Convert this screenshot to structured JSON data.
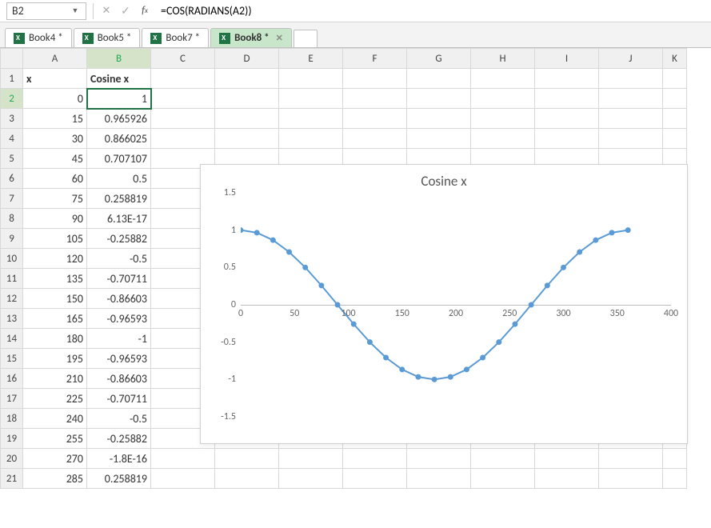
{
  "formula_bar": {
    "name_box": "B2",
    "formula": "=COS(RADIANS(A2))"
  },
  "workbook_tabs": [
    {
      "label": "Book4 *"
    },
    {
      "label": "Book5 *"
    },
    {
      "label": "Book7 *"
    },
    {
      "label": "Book8 *",
      "active": true
    }
  ],
  "columns": [
    "A",
    "B",
    "C",
    "D",
    "E",
    "F",
    "G",
    "H",
    "I",
    "J",
    "K"
  ],
  "header_row": {
    "A": "x",
    "B": "Cosine x"
  },
  "active_cell": "B2",
  "rows": [
    {
      "n": 1,
      "A": "x",
      "B": "Cosine x",
      "hdr": true
    },
    {
      "n": 2,
      "A": "0",
      "B": "1",
      "active": true
    },
    {
      "n": 3,
      "A": "15",
      "B": "0.965926"
    },
    {
      "n": 4,
      "A": "30",
      "B": "0.866025"
    },
    {
      "n": 5,
      "A": "45",
      "B": "0.707107"
    },
    {
      "n": 6,
      "A": "60",
      "B": "0.5"
    },
    {
      "n": 7,
      "A": "75",
      "B": "0.258819"
    },
    {
      "n": 8,
      "A": "90",
      "B": "6.13E-17"
    },
    {
      "n": 9,
      "A": "105",
      "B": "-0.25882"
    },
    {
      "n": 10,
      "A": "120",
      "B": "-0.5"
    },
    {
      "n": 11,
      "A": "135",
      "B": "-0.70711"
    },
    {
      "n": 12,
      "A": "150",
      "B": "-0.86603"
    },
    {
      "n": 13,
      "A": "165",
      "B": "-0.96593"
    },
    {
      "n": 14,
      "A": "180",
      "B": "-1"
    },
    {
      "n": 15,
      "A": "195",
      "B": "-0.96593"
    },
    {
      "n": 16,
      "A": "210",
      "B": "-0.86603"
    },
    {
      "n": 17,
      "A": "225",
      "B": "-0.70711"
    },
    {
      "n": 18,
      "A": "240",
      "B": "-0.5"
    },
    {
      "n": 19,
      "A": "255",
      "B": "-0.25882"
    },
    {
      "n": 20,
      "A": "270",
      "B": "-1.8E-16"
    },
    {
      "n": 21,
      "A": "285",
      "B": "0.258819"
    }
  ],
  "chart_data": {
    "type": "line",
    "title": "Cosine x",
    "xlabel": "",
    "ylabel": "",
    "xlim": [
      0,
      400
    ],
    "ylim": [
      -1.5,
      1.5
    ],
    "xticks": [
      0,
      50,
      100,
      150,
      200,
      250,
      300,
      350,
      400
    ],
    "yticks": [
      -1.5,
      -1,
      -0.5,
      0,
      0.5,
      1,
      1.5
    ],
    "x": [
      0,
      15,
      30,
      45,
      60,
      75,
      90,
      105,
      120,
      135,
      150,
      165,
      180,
      195,
      210,
      225,
      240,
      255,
      270,
      285,
      300,
      315,
      330,
      345,
      360
    ],
    "values": [
      1,
      0.965926,
      0.866025,
      0.707107,
      0.5,
      0.258819,
      0,
      -0.258819,
      -0.5,
      -0.707107,
      -0.866025,
      -0.965926,
      -1,
      -0.965926,
      -0.866025,
      -0.707107,
      -0.5,
      -0.258819,
      0,
      0.258819,
      0.5,
      0.707107,
      0.866025,
      0.965926,
      1
    ],
    "color": "#5b9bd5"
  }
}
